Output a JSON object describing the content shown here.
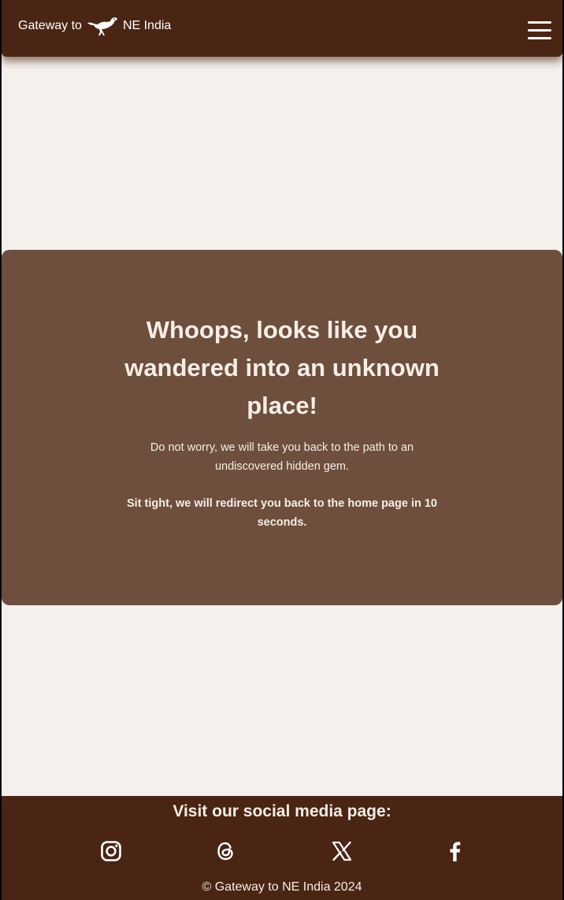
{
  "header": {
    "logo_text_left": "Gateway to",
    "logo_text_right": "NE India",
    "logo_icon": "bird-icon",
    "menu_icon": "hamburger-menu-icon"
  },
  "error_card": {
    "title": "Whoops, looks like you wandered into an unknown place!",
    "message": "Do not worry, we will take you back to the path to an undiscovered hidden gem.",
    "redirect_notice": "Sit tight, we will redirect you back to the home page in 10 seconds."
  },
  "footer": {
    "social_heading": "Visit our social media page:",
    "social_links": [
      {
        "icon": "instagram-icon"
      },
      {
        "icon": "threads-icon"
      },
      {
        "icon": "x-icon"
      },
      {
        "icon": "facebook-icon"
      }
    ],
    "copyright": "© Gateway to NE India 2024"
  },
  "colors": {
    "header_background": "#4a2514",
    "page_background": "#f4f0eb",
    "card_background": "#6e4e3d",
    "footer_background": "#4a2514",
    "text_light": "#f6eee6"
  }
}
